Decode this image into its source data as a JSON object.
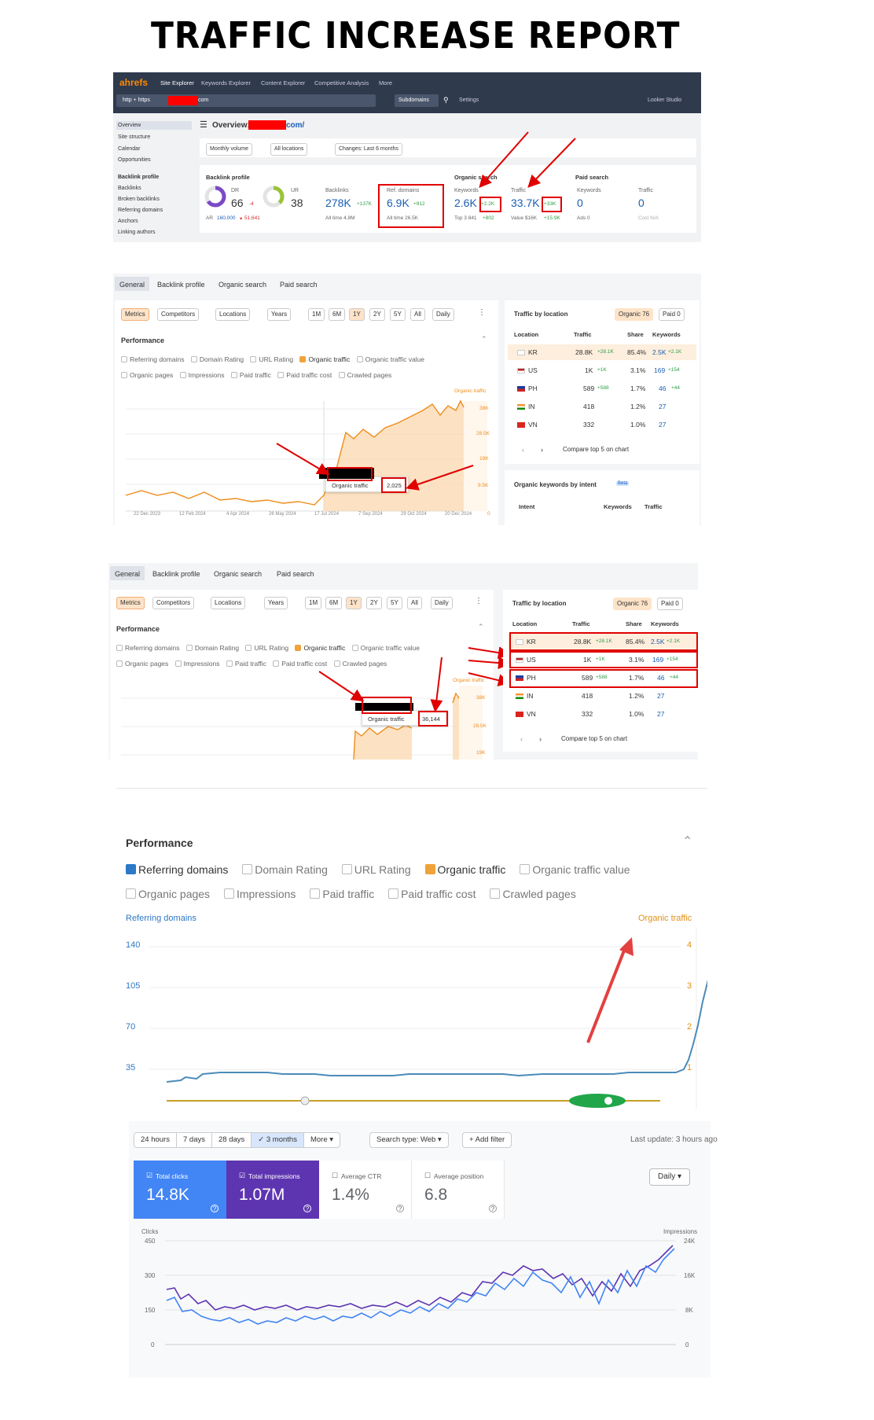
{
  "report_title": "TRAFFIC INCREASE REPORT",
  "ahrefs": {
    "logo": "ahrefs",
    "nav": [
      "Site Explorer",
      "Keywords Explorer",
      "Content Explorer",
      "Competitive Analysis",
      "More"
    ],
    "protocol": "http + https",
    "url_suffix": "com",
    "mode": "Subdomains",
    "settings": "Settings",
    "looker": "Looker Studio",
    "sidebar": [
      "Overview",
      "Site structure",
      "Calendar",
      "Opportunities"
    ],
    "sidebar_group": "Backlink profile",
    "sidebar2": [
      "Backlinks",
      "Broken backlinks",
      "Referring domains",
      "Anchors",
      "Linking authors"
    ],
    "overview_prefix": "Overview:",
    "overview_suffix": "com/",
    "filters": [
      "Monthly volume",
      "All locations",
      "Changes: Last 6 months"
    ],
    "backlink_profile": "Backlink profile",
    "organic_search": "Organic search",
    "paid_search": "Paid search",
    "dr_label": "DR",
    "dr_value": "66",
    "dr_change": "-4",
    "ur_label": "UR",
    "ur_value": "38",
    "ar_label": "AR",
    "ar_value": "160,000",
    "ar_change": "51,641",
    "backlinks_label": "Backlinks",
    "backlinks_value": "278K",
    "backlinks_change": "+137K",
    "backlinks_all": "All time 4.8M",
    "refdom_label": "Ref. domains",
    "refdom_value": "6.9K",
    "refdom_change": "+912",
    "refdom_all": "All time 26.5K",
    "kw_label": "Keywords",
    "kw_value": "2.6K",
    "kw_change": "+2.2K",
    "kw_top": "Top 3 841",
    "kw_top_change": "+802",
    "tr_label": "Traffic",
    "tr_value": "33.7K",
    "tr_change": "+33K",
    "tr_val": "Value $16K",
    "tr_val_change": "+15.9K",
    "pkw_label": "Keywords",
    "pkw_value": "0",
    "pkw_ads": "Ads 0",
    "ptr_label": "Traffic",
    "ptr_value": "0",
    "ptr_cost": "Cost N/A"
  },
  "perf": {
    "tabs": [
      "General",
      "Backlink profile",
      "Organic search",
      "Paid search"
    ],
    "toolbar": [
      "Metrics",
      "Competitors",
      "Locations",
      "Years"
    ],
    "ranges": [
      "1M",
      "6M",
      "1Y",
      "2Y",
      "5Y",
      "All"
    ],
    "interval": "Daily",
    "title": "Performance",
    "checks1": [
      "Referring domains",
      "Domain Rating",
      "URL Rating",
      "Organic traffic",
      "Organic traffic value"
    ],
    "checks2": [
      "Organic pages",
      "Impressions",
      "Paid traffic",
      "Paid traffic cost",
      "Crawled pages"
    ],
    "series_label": "Organic traffic",
    "y_ticks": [
      "38K",
      "28.5K",
      "19K",
      "9.5K",
      "0"
    ],
    "x_ticks": [
      "22 Dec 2023",
      "12 Feb 2024",
      "4 Apr 2024",
      "26 May 2024",
      "17 Jul 2024",
      "7 Sep 2024",
      "29 Oct 2024",
      "20 Dec 2024"
    ],
    "tooltip1_label": "Organic traffic",
    "tooltip1_value": "2,025",
    "tooltip2_label": "Organic traffic",
    "tooltip2_value": "36,144",
    "loc_title": "Traffic by location",
    "loc_organic": "Organic 76",
    "loc_paid": "Paid 0",
    "loc_headers": [
      "Location",
      "Traffic",
      "Share",
      "Keywords"
    ],
    "locations": [
      {
        "code": "KR",
        "traffic": "28.8K",
        "tchg": "+28.1K",
        "share": "85.4%",
        "kw": "2.5K",
        "kchg": "+2.1K"
      },
      {
        "code": "US",
        "traffic": "1K",
        "tchg": "+1K",
        "share": "3.1%",
        "kw": "169",
        "kchg": "+154"
      },
      {
        "code": "PH",
        "traffic": "589",
        "tchg": "+588",
        "share": "1.7%",
        "kw": "46",
        "kchg": "+44"
      },
      {
        "code": "IN",
        "traffic": "418",
        "tchg": "",
        "share": "1.2%",
        "kw": "27",
        "kchg": ""
      },
      {
        "code": "VN",
        "traffic": "332",
        "tchg": "",
        "share": "1.0%",
        "kw": "27",
        "kchg": ""
      }
    ],
    "compare": "Compare top 5 on chart",
    "intent_title": "Organic keywords by intent",
    "intent_beta": "Beta",
    "intent_headers": [
      "Intent",
      "Keywords",
      "Traffic"
    ],
    "y_ticks2": [
      "38K",
      "28.5K",
      "19K"
    ]
  },
  "zoom": {
    "title": "Performance",
    "checks1": [
      "Referring domains",
      "Domain Rating",
      "URL Rating",
      "Organic traffic",
      "Organic traffic value"
    ],
    "checks2": [
      "Organic pages",
      "Impressions",
      "Paid traffic",
      "Paid traffic cost",
      "Crawled pages"
    ],
    "left_label": "Referring domains",
    "right_label": "Organic traffic",
    "left_ticks": [
      "140",
      "105",
      "70",
      "35"
    ],
    "right_ticks": [
      "4",
      "3",
      "2",
      "1"
    ]
  },
  "gsc": {
    "ranges": [
      "24 hours",
      "7 days",
      "28 days",
      "3 months",
      "More"
    ],
    "search_type": "Search type: Web",
    "add_filter": "Add filter",
    "last_update": "Last update: 3 hours ago",
    "clicks_label": "Total clicks",
    "clicks_value": "14.8K",
    "impr_label": "Total impressions",
    "impr_value": "1.07M",
    "ctr_label": "Average CTR",
    "ctr_value": "1.4%",
    "pos_label": "Average position",
    "pos_value": "6.8",
    "interval": "Daily",
    "left_axis": "Clicks",
    "right_axis": "Impressions",
    "left_ticks": [
      "450",
      "300",
      "150",
      "0"
    ],
    "right_ticks": [
      "24K",
      "16K",
      "8K",
      "0"
    ]
  }
}
